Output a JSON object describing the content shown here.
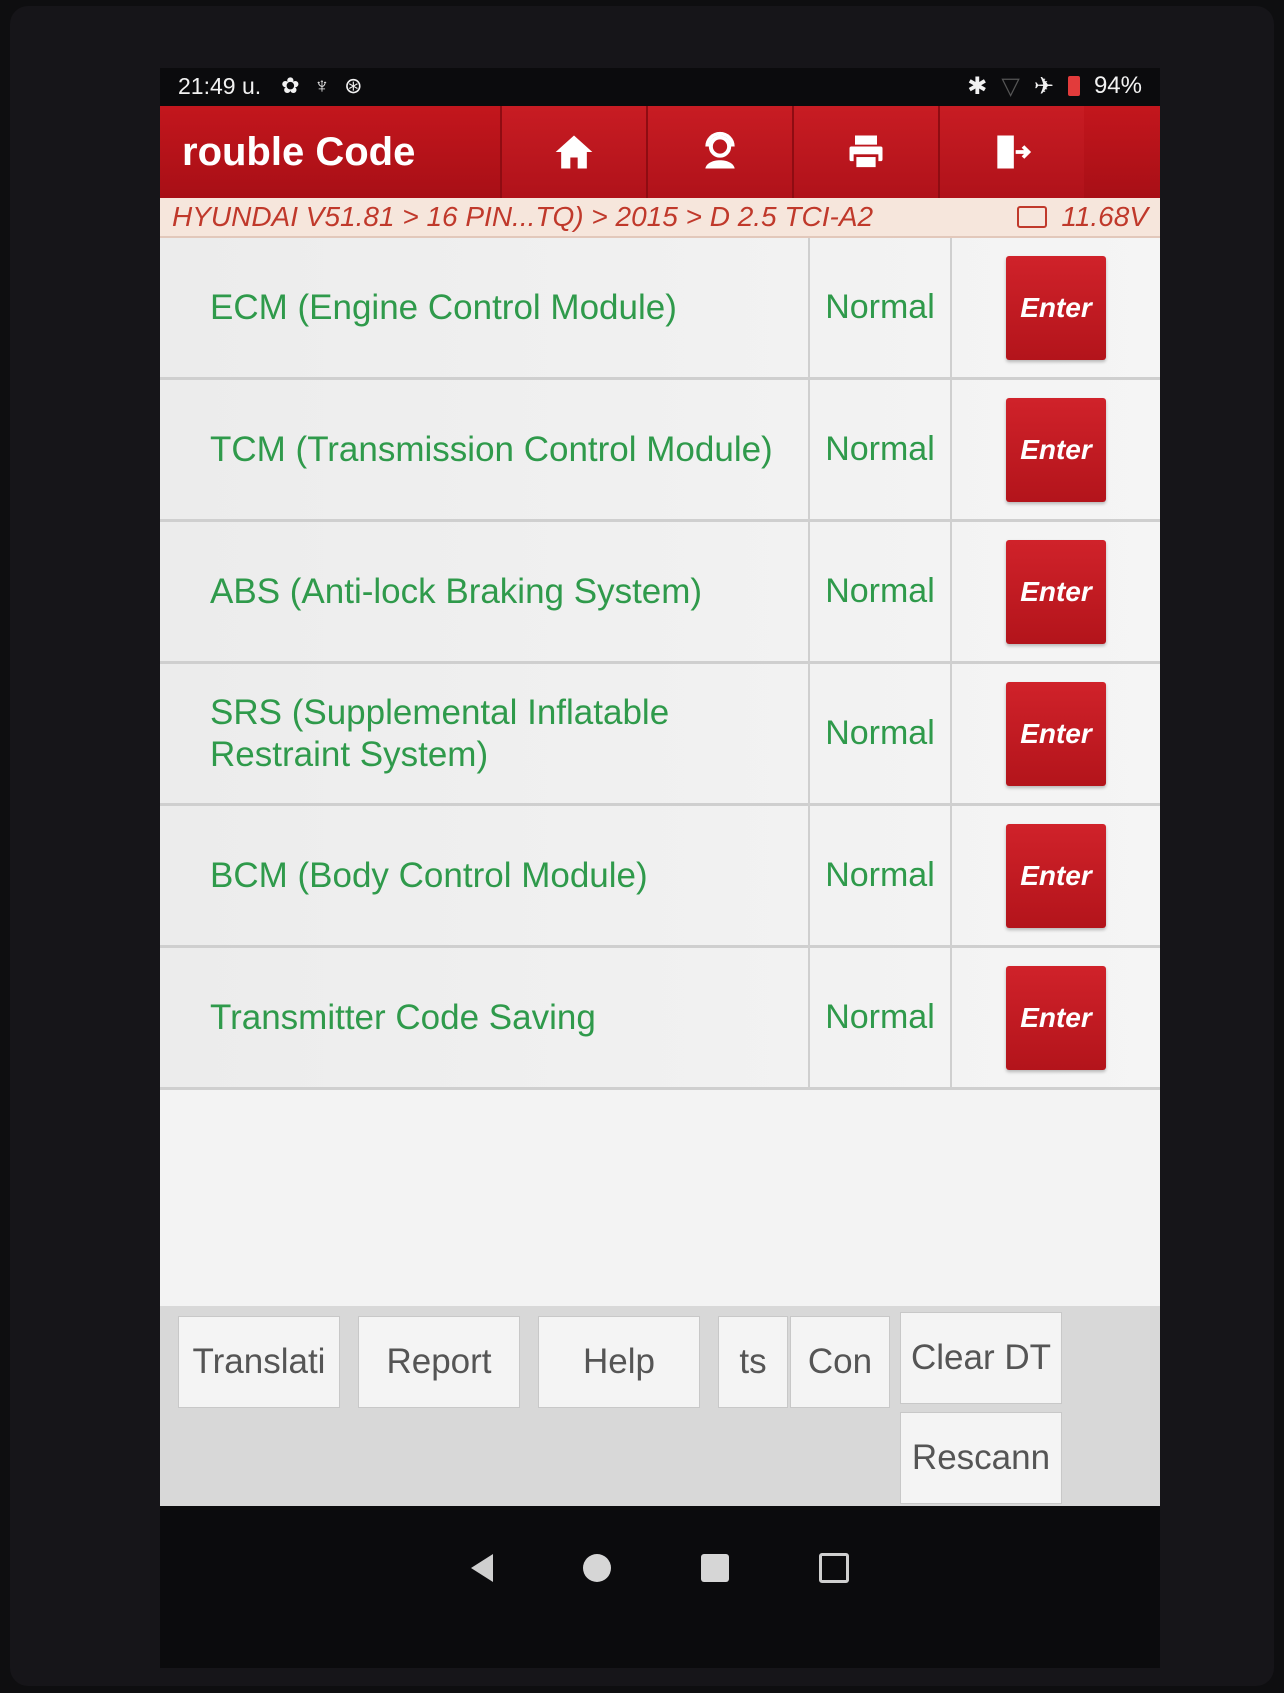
{
  "status_bar": {
    "time": "21:49 u.",
    "battery": "94%"
  },
  "header": {
    "title": "rouble Code",
    "buttons": [
      "home-icon",
      "support-icon",
      "print-icon",
      "exit-icon"
    ]
  },
  "breadcrumb": {
    "path": "HYUNDAI V51.81 > 16 PIN...TQ) > 2015 > D 2.5 TCI-A2",
    "voltage": "11.68V"
  },
  "modules": [
    {
      "name": "ECM (Engine Control Module)",
      "status": "Normal",
      "action": "Enter"
    },
    {
      "name": "TCM (Transmission Control Module)",
      "status": "Normal",
      "action": "Enter"
    },
    {
      "name": "ABS (Anti-lock Braking System)",
      "status": "Normal",
      "action": "Enter"
    },
    {
      "name": "SRS (Supplemental Inflatable Restraint System)",
      "status": "Normal",
      "action": "Enter"
    },
    {
      "name": "BCM (Body Control Module)",
      "status": "Normal",
      "action": "Enter"
    },
    {
      "name": "Transmitter Code Saving",
      "status": "Normal",
      "action": "Enter"
    }
  ],
  "bottom_buttons": {
    "translate": "Translati",
    "report": "Report",
    "help": "Help",
    "ts": "ts",
    "con": "Con",
    "clear_dtc": "Clear DT",
    "rescan": "Rescann"
  },
  "colors": {
    "header_red": "#b8131b",
    "module_green": "#2f9a4b",
    "breadcrumb_text": "#c0392b"
  }
}
